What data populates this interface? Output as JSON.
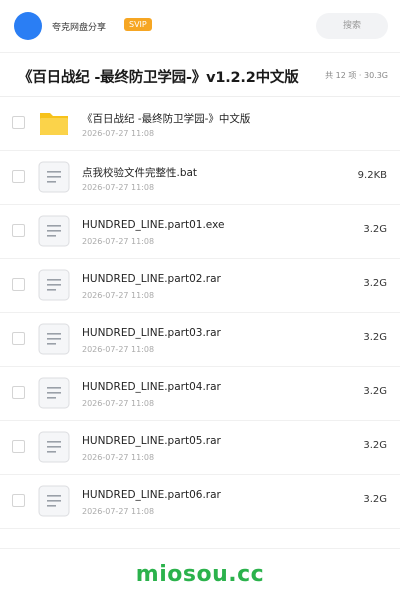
{
  "header": {
    "username": "夸克网盘分享",
    "vip_badge": "SVIP",
    "search_label": "搜索"
  },
  "share": {
    "title": "《百日战纪 -最终防卫学园-》v1.2.2中文版",
    "meta": "共 12 项 · 30.3G"
  },
  "files": [
    {
      "name": "《百日战纪 -最终防卫学园-》中文版",
      "date": "2026-07-27 11:08",
      "size": "",
      "icon": "folder-icon"
    },
    {
      "name": "点我校验文件完整性.bat",
      "date": "2026-07-27 11:08",
      "size": "9.2KB",
      "icon": "document-icon"
    },
    {
      "name": "HUNDRED_LINE.part01.exe",
      "date": "2026-07-27 11:08",
      "size": "3.2G",
      "icon": "document-icon"
    },
    {
      "name": "HUNDRED_LINE.part02.rar",
      "date": "2026-07-27 11:08",
      "size": "3.2G",
      "icon": "document-icon"
    },
    {
      "name": "HUNDRED_LINE.part03.rar",
      "date": "2026-07-27 11:08",
      "size": "3.2G",
      "icon": "document-icon"
    },
    {
      "name": "HUNDRED_LINE.part04.rar",
      "date": "2026-07-27 11:08",
      "size": "3.2G",
      "icon": "document-icon"
    },
    {
      "name": "HUNDRED_LINE.part05.rar",
      "date": "2026-07-27 11:08",
      "size": "3.2G",
      "icon": "document-icon"
    },
    {
      "name": "HUNDRED_LINE.part06.rar",
      "date": "2026-07-27 11:08",
      "size": "3.2G",
      "icon": "document-icon"
    }
  ],
  "watermark": "miosou.cc",
  "colors": {
    "avatar": "#2a7ef4",
    "vip": "#f6a623",
    "folder": "#f7c21a",
    "watermark": "#2bb24c"
  }
}
